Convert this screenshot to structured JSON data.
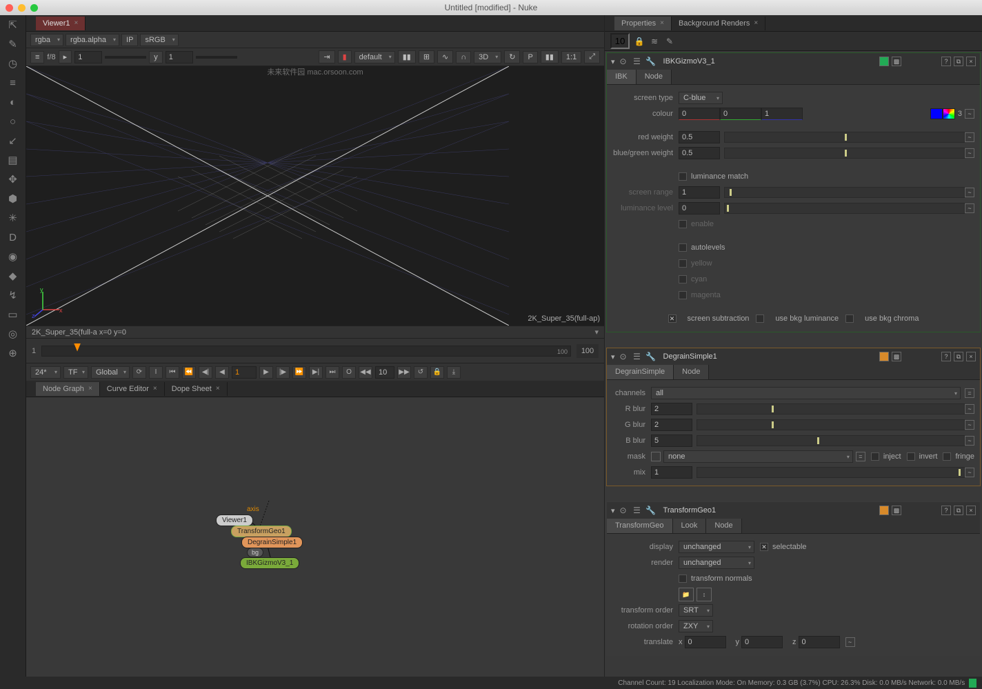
{
  "window": {
    "title": "Untitled [modified] - Nuke"
  },
  "watermark": "未来软件园\nmac.orsoon.com",
  "left_tools": [
    "⇱",
    "✎",
    "◷",
    "≡",
    "◐",
    "○",
    "↙",
    "▤",
    "✥",
    "⬢",
    "✳",
    "D",
    "◉",
    "◆",
    "↯",
    "▭",
    "◎",
    "⊕"
  ],
  "main_tabs": {
    "viewer": "Viewer1"
  },
  "channel_row": {
    "channel": "rgba",
    "alpha": "rgba.alpha",
    "ip_label": "IP",
    "colorspace": "sRGB"
  },
  "viewer_bar": {
    "fstop": "f/8",
    "gain": "1",
    "x_arrow": "▸",
    "ylabel": "y",
    "gamma": "1",
    "default": "default",
    "mode": "3D",
    "zoom": "1:1"
  },
  "viewport": {
    "format_label": "2K_Super_35(full-ap)",
    "status": "2K_Super_35(full-a  x=0 y=0"
  },
  "axis_labels": {
    "x": "x",
    "y": "y",
    "z": "z"
  },
  "timeline": {
    "start": "1",
    "end": "100",
    "current": "1",
    "track_start": "1",
    "track_end": "100"
  },
  "playback": {
    "rate": "24*",
    "tf": "TF",
    "scope": "Global",
    "frame": "1",
    "step": "10"
  },
  "node_tabs": {
    "a": "Node Graph",
    "b": "Curve Editor",
    "c": "Dope Sheet"
  },
  "nodes": {
    "axis_label": "axis",
    "viewer": "Viewer1",
    "transform": "TransformGeo1",
    "degrain": "DegrainSimple1",
    "bg": "bg",
    "ibk": "IBKGizmoV3_1"
  },
  "right_tabs": {
    "a": "Properties",
    "b": "Background Renders"
  },
  "props_header": {
    "count": "10"
  },
  "panel1": {
    "title": "IBKGizmoV3_1",
    "tabs": {
      "a": "IBK",
      "b": "Node"
    },
    "screen_type_label": "screen type",
    "screen_type": "C-blue",
    "colour_label": "colour",
    "colour_r": "0",
    "colour_g": "0",
    "colour_b": "1",
    "colour_count": "3",
    "red_weight_label": "red weight",
    "red_weight": "0.5",
    "bg_weight_label": "blue/green weight",
    "bg_weight": "0.5",
    "lum_match": "luminance match",
    "screen_range_label": "screen range",
    "screen_range": "1",
    "lum_level_label": "luminance level",
    "lum_level": "0",
    "enable": "enable",
    "autolevels": "autolevels",
    "yellow": "yellow",
    "cyan": "cyan",
    "magenta": "magenta",
    "screen_sub": "screen subtraction",
    "use_bkg_lum": "use bkg luminance",
    "use_bkg_chroma": "use bkg chroma"
  },
  "panel2": {
    "title": "DegrainSimple1",
    "tabs": {
      "a": "DegrainSimple",
      "b": "Node"
    },
    "channels_label": "channels",
    "channels": "all",
    "rblur_label": "R blur",
    "rblur": "2",
    "gblur_label": "G blur",
    "gblur": "2",
    "bblur_label": "B blur",
    "bblur": "5",
    "mask_label": "mask",
    "mask": "none",
    "inject": "inject",
    "invert": "invert",
    "fringe": "fringe",
    "mix_label": "mix",
    "mix": "1"
  },
  "panel3": {
    "title": "TransformGeo1",
    "tabs": {
      "a": "TransformGeo",
      "b": "Look",
      "c": "Node"
    },
    "display_label": "display",
    "display": "unchanged",
    "render_label": "render",
    "render": "unchanged",
    "selectable": "selectable",
    "transform_normals": "transform normals",
    "transform_order_label": "transform order",
    "transform_order": "SRT",
    "rotation_order_label": "rotation order",
    "rotation_order": "ZXY",
    "translate_label": "translate",
    "tx": "0",
    "ty": "0",
    "tz": "0",
    "xl": "x",
    "yl": "y",
    "zl": "z"
  },
  "footer": "Channel Count: 19 Localization Mode: On Memory: 0.3 GB (3.7%) CPU: 26.3% Disk: 0.0 MB/s Network: 0.0 MB/s"
}
